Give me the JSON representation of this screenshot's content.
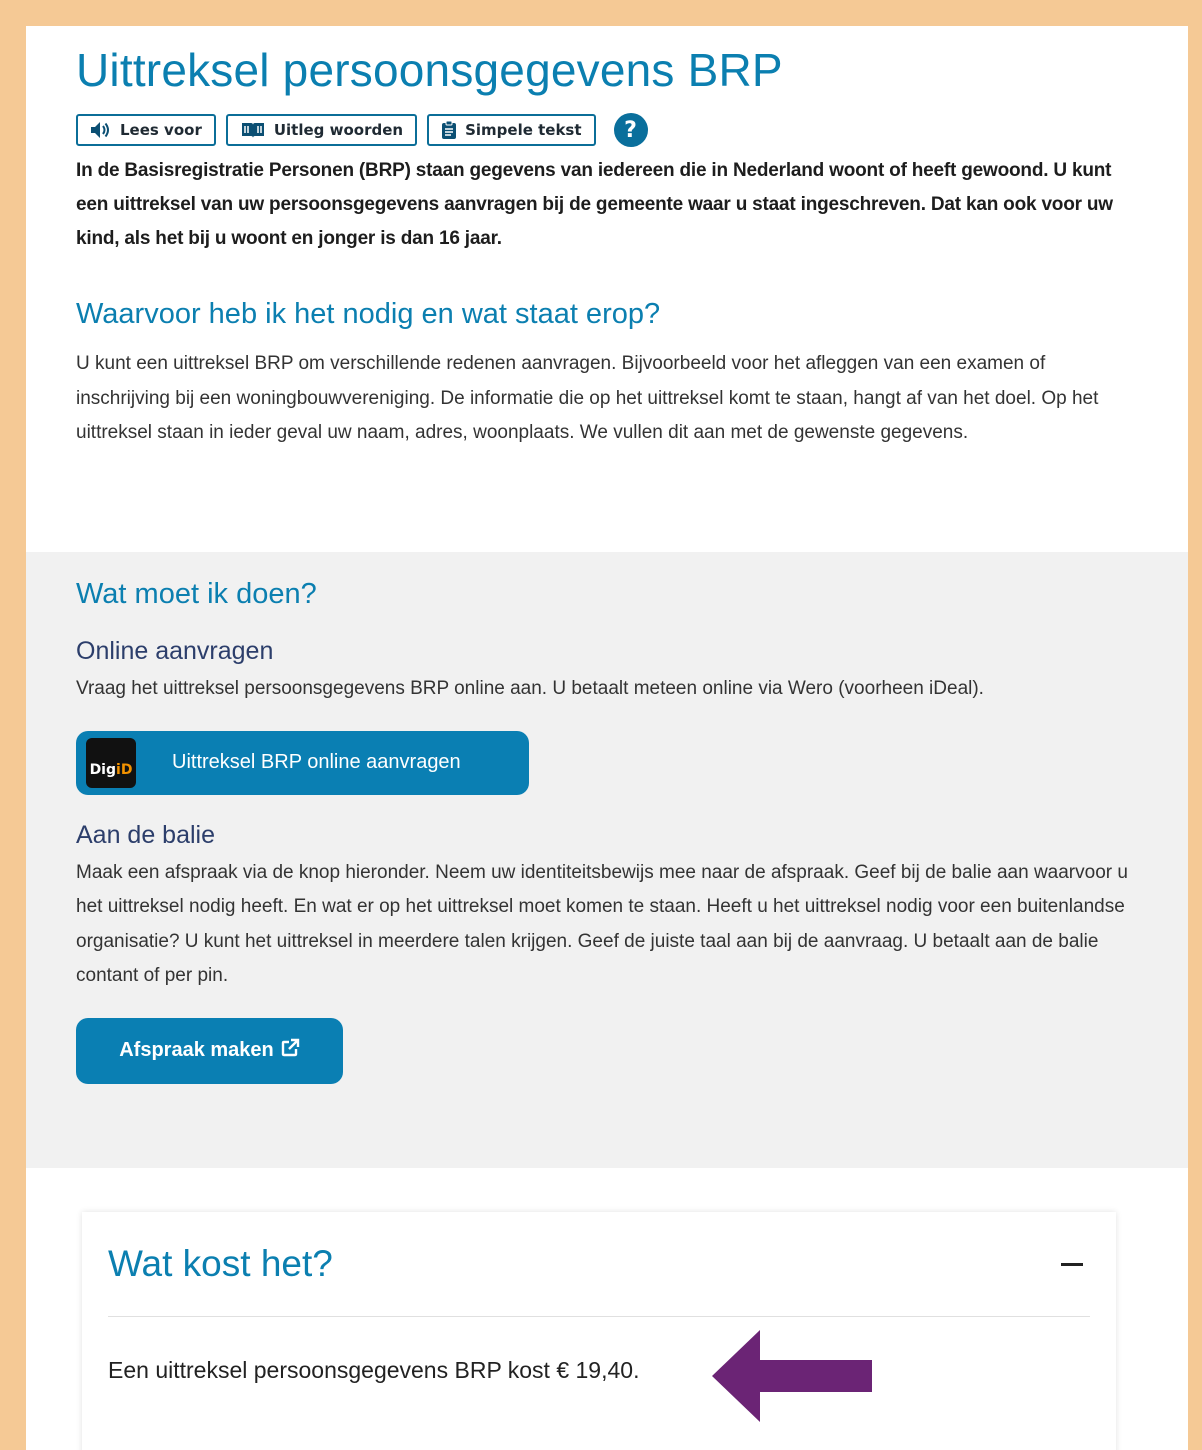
{
  "page": {
    "title": "Uittreksel persoonsgegevens BRP"
  },
  "toolbar": {
    "read_aloud": "Lees voor",
    "explain_words": "Uitleg woorden",
    "simple_text": "Simpele tekst",
    "help": "?"
  },
  "intro": "In de Basisregistratie Personen (BRP) staan gegevens van iedereen die in Nederland woont of heeft gewoond. U kunt een uittreksel van uw persoonsgegevens aanvragen bij de gemeente waar u staat ingeschreven. Dat kan ook voor uw kind, als het bij u woont en jonger is dan 16 jaar.",
  "why": {
    "heading": "Waarvoor heb ik het nodig en wat staat erop?",
    "text": "U kunt een uittreksel BRP om verschillende redenen aanvragen. Bijvoorbeeld voor het afleggen van een examen of inschrijving bij een woningbouwvereniging. De informatie die op het uittreksel komt te staan, hangt af van het doel. Op het uittreksel staan in ieder geval uw naam, adres, woonplaats. We vullen dit aan met de gewenste gegevens."
  },
  "todo": {
    "heading": "Wat moet ik doen?",
    "online_heading": "Online aanvragen",
    "online_text": "Vraag het uittreksel persoonsgegevens BRP online aan. U betaalt meteen online via Wero (voorheen iDeal).",
    "digid_logo_a": "Dig",
    "digid_logo_b": "iD",
    "online_button": "Uittreksel BRP online aanvragen",
    "balie_heading": "Aan de balie",
    "balie_text": "Maak een afspraak via de knop hieronder. Neem uw identiteitsbewijs mee naar de afspraak. Geef bij de balie aan waarvoor u het uittreksel nodig heeft. En wat er op het uittreksel moet komen te staan. Heeft u het uittreksel nodig voor een buitenlandse organisatie? U kunt het uittreksel in meerdere talen krijgen. Geef de juiste taal aan bij de aanvraag. U betaalt aan de balie contant of per pin.",
    "appointment_button": "Afspraak maken"
  },
  "cost": {
    "heading": "Wat kost het?",
    "text": "Een uittreksel persoonsgegevens BRP kost € 19,40."
  },
  "icons": {
    "read_aloud": "speaker-icon",
    "explain_words": "book-icon",
    "simple_text": "clipboard-icon",
    "external_link": "external-link-icon",
    "annotation_arrow": "arrow-left-icon"
  },
  "colors": {
    "heading_blue": "#0b7fb0",
    "button_blue": "#0a7fb3",
    "frame": "#f5c995",
    "grey_section": "#f1f1f1",
    "arrow": "#6b2475"
  }
}
